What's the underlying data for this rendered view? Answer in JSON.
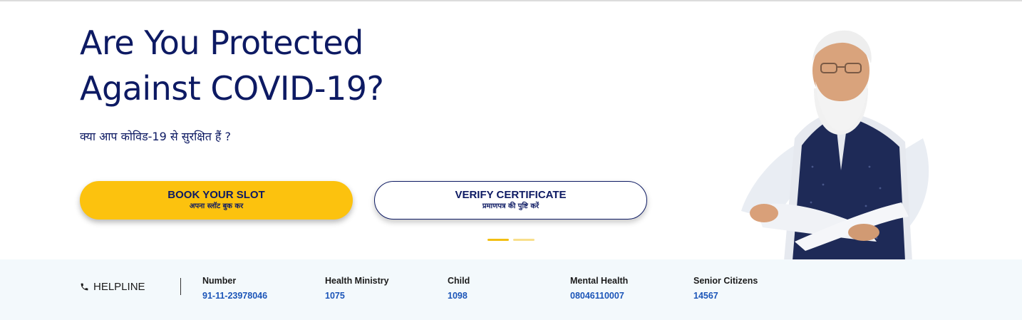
{
  "hero": {
    "headline_line1": "Are You Protected",
    "headline_line2": "Against COVID-19?",
    "subtitle": "क्या आप कोविड-19 से सुरक्षित हैं ?",
    "book_button": {
      "label": "BOOK YOUR SLOT",
      "sublabel": "अपना स्लॉट बुक कर"
    },
    "verify_button": {
      "label": "VERIFY CERTIFICATE",
      "sublabel": "प्रमाणपत्र की पुष्टि करें"
    },
    "carousel": {
      "slides": 2,
      "active": 1
    }
  },
  "helpline": {
    "label": "HELPLINE",
    "items": [
      {
        "title": "Number",
        "value": "91-11-23978046"
      },
      {
        "title": "Health Ministry",
        "value": "1075"
      },
      {
        "title": "Child",
        "value": "1098"
      },
      {
        "title": "Mental Health",
        "value": "08046110007"
      },
      {
        "title": "Senior Citizens",
        "value": "14567"
      }
    ]
  },
  "colors": {
    "navy": "#0d1a63",
    "accent_yellow": "#fcc20e",
    "link_blue": "#1b55b8",
    "helpline_bg": "#f3f9fc"
  },
  "icons": {
    "helpline_icon": "phone-icon"
  }
}
